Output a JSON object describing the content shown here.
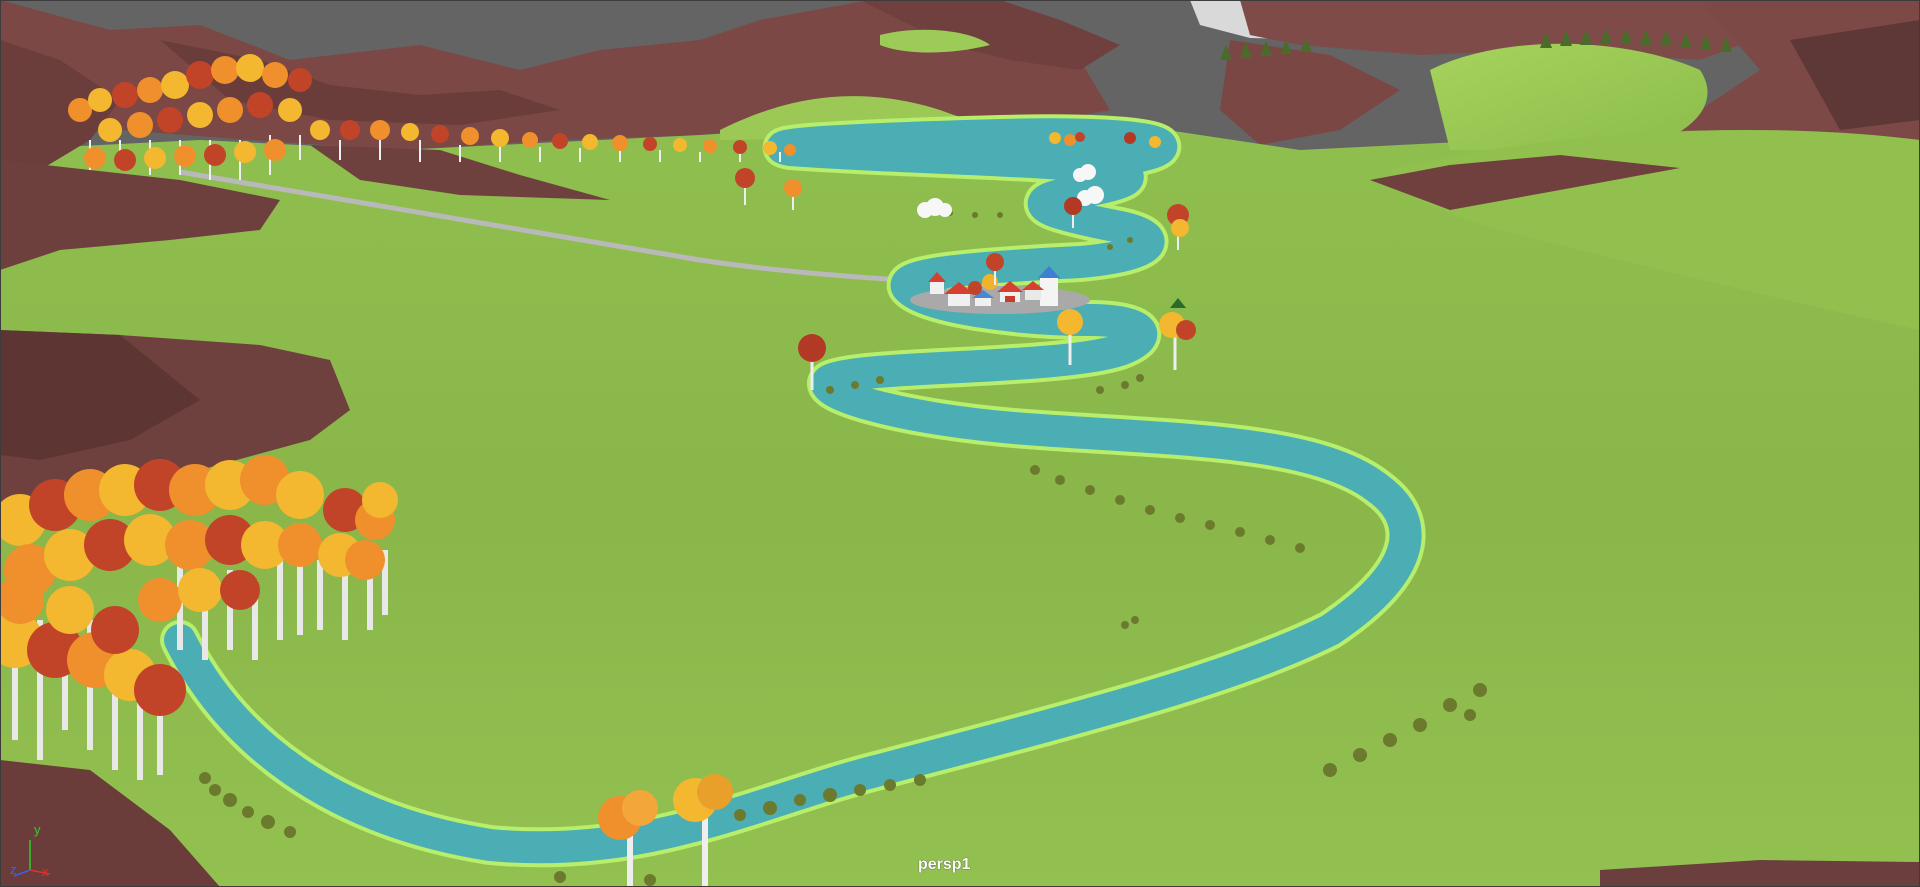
{
  "viewport": {
    "camera_label": "persp1",
    "axes": {
      "y": {
        "label": "y",
        "color": "#2ad12a"
      },
      "x": {
        "label": "x",
        "color": "#e0302a"
      },
      "z": {
        "label": "z",
        "color": "#3a62e8"
      }
    }
  },
  "colors": {
    "sky": "#646464",
    "grass": "#8cba4c",
    "grass_light": "#9fcb58",
    "mountain": "#7a4a47",
    "mountain_dark": "#5a3533",
    "river": "#4aaeb4",
    "river_edge": "#b8ef6a",
    "trunk": "#ececec",
    "foliage_orange": "#f0902c",
    "foliage_yellow": "#f3b730",
    "foliage_red": "#b23a25"
  }
}
